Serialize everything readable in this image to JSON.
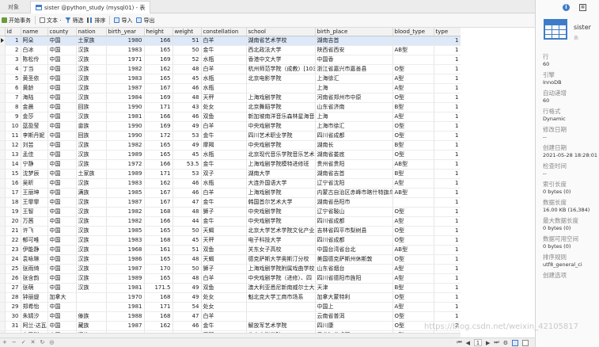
{
  "tabs": {
    "objects_label": "对象",
    "active_label": "sister @python_study (mysql01) - 表"
  },
  "toolbar": {
    "begin_tx": "开始事务",
    "text": "文本 ·",
    "filter": "筛选",
    "sort": "排序",
    "import": "导入",
    "export": "导出"
  },
  "grid": {
    "columns": [
      "id",
      "name",
      "county",
      "nation",
      "birth_year",
      "height",
      "weight",
      "constellation",
      "school",
      "birth_place",
      "blood_type",
      "type"
    ],
    "rows": [
      [
        "1",
        "阿朵",
        "中国",
        "土家族",
        "1980",
        "166",
        "51",
        "白羊",
        "湖南省艺术学校",
        "湖南吉首",
        "",
        "1"
      ],
      [
        "2",
        "白冰",
        "中国",
        "汉族",
        "1983",
        "165",
        "50",
        "金牛",
        "西北政法大学",
        "陕西省西安",
        "AB型",
        "1"
      ],
      [
        "3",
        "陈松伶",
        "中国",
        "汉族",
        "1971",
        "169",
        "52",
        "水瓶",
        "香港中文大学",
        "中国香",
        "",
        "1"
      ],
      [
        "4",
        "丁当",
        "中国",
        "汉族",
        "1982",
        "162",
        "48",
        "白羊",
        "杭州师范学院（成教）[103",
        "浙江省嘉兴市嘉善县",
        "O型",
        "1"
      ],
      [
        "5",
        "黄圣依",
        "中国",
        "汉族",
        "1983",
        "165",
        "45",
        "水瓶",
        "北京电影学院",
        "上海徐汇",
        "A型",
        "1"
      ],
      [
        "6",
        "黄龄",
        "中国",
        "汉族",
        "1987",
        "167",
        "46",
        "水瓶",
        "",
        "上海",
        "A型",
        "1"
      ],
      [
        "7",
        "海陆",
        "中国",
        "汉族",
        "1984",
        "169",
        "48",
        "天秤",
        "上海戏剧学院",
        "河南省郑州市中原",
        "O型",
        "1"
      ],
      [
        "8",
        "金晨",
        "中国",
        "回族",
        "1990",
        "171",
        "43",
        "处女",
        "北京舞蹈学院",
        "山东省济南",
        "B型",
        "1"
      ],
      [
        "9",
        "金莎",
        "中国",
        "汉族",
        "1981",
        "166",
        "46",
        "双鱼",
        "新加坡南洋音乐森林星海音",
        "上海",
        "A型",
        "1"
      ],
      [
        "10",
        "蓝盈莹",
        "中国",
        "畲族",
        "1990",
        "169",
        "49",
        "白羊",
        "中央戏剧学院",
        "上海市徐汇",
        "O型",
        "1"
      ],
      [
        "11",
        "李斯丹妮",
        "中国",
        "回族",
        "1990",
        "172",
        "53",
        "金牛",
        "四川艺术职业学院",
        "四川省成都",
        "O型",
        "1"
      ],
      [
        "12",
        "刘芸",
        "中国",
        "汉族",
        "1982",
        "165",
        "49",
        "摩羯",
        "中央戏剧学院",
        "湖南长",
        "B型",
        "1"
      ],
      [
        "13",
        "孟佳",
        "中国",
        "汉族",
        "1989",
        "165",
        "45",
        "水瓶",
        "北京现代音乐学院音乐艺术",
        "湖南省娄底",
        "O型",
        "1"
      ],
      [
        "14",
        "宁静",
        "中国",
        "汉族",
        "1972",
        "166",
        "53.5",
        "金牛",
        "上海戏剧学院模特进修班",
        "贵州省贵阳",
        "AB型",
        "1"
      ],
      [
        "15",
        "沈梦辰",
        "中国",
        "土家族",
        "1989",
        "171",
        "53",
        "双子",
        "湖南大学",
        "湖南省吉首",
        "B型",
        "1"
      ],
      [
        "16",
        "吴昕",
        "中国",
        "汉族",
        "1983",
        "162",
        "46",
        "水瓶",
        "大连外国语大学",
        "辽宁省沈阳",
        "A型",
        "1"
      ],
      [
        "17",
        "王丽坤",
        "中国",
        "满族",
        "1985",
        "167",
        "46",
        "白羊",
        "上海戏剧学院",
        "内蒙古自治区赤峰市喀什特旗乌",
        "AB型",
        "1"
      ],
      [
        "18",
        "王霏霏",
        "中国",
        "汉族",
        "1987",
        "167",
        "47",
        "金牛",
        "韩国首尔艺术大学",
        "湖南省岳阳市",
        "",
        "1"
      ],
      [
        "19",
        "王智",
        "中国",
        "汉族",
        "1982",
        "168",
        "48",
        "狮子",
        "中央戏剧学院",
        "辽宁省鞍山",
        "O型",
        "1"
      ],
      [
        "20",
        "万茜",
        "中国",
        "汉族",
        "1982",
        "166",
        "44",
        "金牛",
        "中央戏剧学院",
        "四川省成都",
        "A型",
        "1"
      ],
      [
        "21",
        "许飞",
        "中国",
        "汉族",
        "1985",
        "165",
        "50",
        "天蝎",
        "北京大学艺术学院文化产业",
        "吉林省四平市梨树县",
        "O型",
        "1"
      ],
      [
        "22",
        "郁可唯",
        "中国",
        "汉族",
        "1983",
        "168",
        "45",
        "天秤",
        "电子科技大学",
        "四川省成都",
        "O型",
        "1"
      ],
      [
        "23",
        "伊能静",
        "中国",
        "汉族",
        "1968",
        "161",
        "51",
        "双鱼",
        "关东女子高校",
        "中国台湾省台北",
        "AB型",
        "1"
      ],
      [
        "24",
        "袁咏琳",
        "中国",
        "汉族",
        "1986",
        "165",
        "48",
        "天蝎",
        "德克萨斯大学奥斯汀分校",
        "美国德克萨斯州休斯敦",
        "O型",
        "1"
      ],
      [
        "25",
        "张雨绮",
        "中国",
        "汉族",
        "1987",
        "170",
        "50",
        "狮子",
        "上海戏剧学院附属戏曲学校",
        "山东省烟台",
        "A型",
        "1"
      ],
      [
        "26",
        "张含韵",
        "中国",
        "汉族",
        "1989",
        "165",
        "48",
        "白羊",
        "中央戏剧学院（进修）、四",
        "四川省德阳市旌阳",
        "A型",
        "1"
      ],
      [
        "27",
        "张萌",
        "中国",
        "汉族",
        "1981",
        "171.5",
        "49",
        "双鱼",
        "澳大利亚悉尼新南威尔士大",
        "天津",
        "B型",
        "1"
      ],
      [
        "28",
        "钟丽缇",
        "加拿大",
        "",
        "1970",
        "168",
        "49",
        "处女",
        "魁北克大学工商市场系",
        "加拿大蒙特利",
        "O型",
        "1"
      ],
      [
        "29",
        "郑希怡",
        "中国",
        "",
        "1981",
        "171",
        "54",
        "处女",
        "",
        "中国上",
        "A型",
        "1"
      ],
      [
        "30",
        "朱婧汐",
        "中国",
        "傣族",
        "1988",
        "168",
        "47",
        "白羊",
        "",
        "云南省普洱",
        "O型",
        "1"
      ],
      [
        "31",
        "阿兰·达瓦",
        "中国",
        "藏族",
        "1987",
        "162",
        "46",
        "金牛",
        "解放军艺术学院",
        "四川康",
        "O型",
        "2"
      ],
      [
        "32",
        "安又琪",
        "中国",
        "汉族",
        "1982",
        "165",
        "48",
        "天秤",
        "北京电影学院",
        "黑龙江省鸡西",
        "B型",
        "2"
      ]
    ]
  },
  "statusbar": {
    "page": "1"
  },
  "side": {
    "name": "sister",
    "subtitle": "表",
    "props": [
      {
        "label": "行",
        "value": "60"
      },
      {
        "label": "引擎",
        "value": "InnoDB"
      },
      {
        "label": "自动递增",
        "value": "60"
      },
      {
        "label": "行格式",
        "value": "Dynamic"
      },
      {
        "label": "修改日期",
        "value": "--"
      },
      {
        "label": "创建日期",
        "value": "2021-05-28 18:28:01"
      },
      {
        "label": "检查时间",
        "value": "--"
      },
      {
        "label": "索引长度",
        "value": "0 bytes (0)"
      },
      {
        "label": "数据长度",
        "value": "16.00 KB (16,384)"
      },
      {
        "label": "最大数据长度",
        "value": "0 bytes (0)"
      },
      {
        "label": "数据可用空间",
        "value": "0 bytes (0)"
      },
      {
        "label": "排序规则",
        "value": "utf8_general_ci"
      },
      {
        "label": "创建选项",
        "value": ""
      }
    ]
  },
  "watermark": "https://blog.csdn.net/weixin_42105817",
  "colors": {
    "accent": "#3d7cc9",
    "selection": "#dde8f8"
  }
}
